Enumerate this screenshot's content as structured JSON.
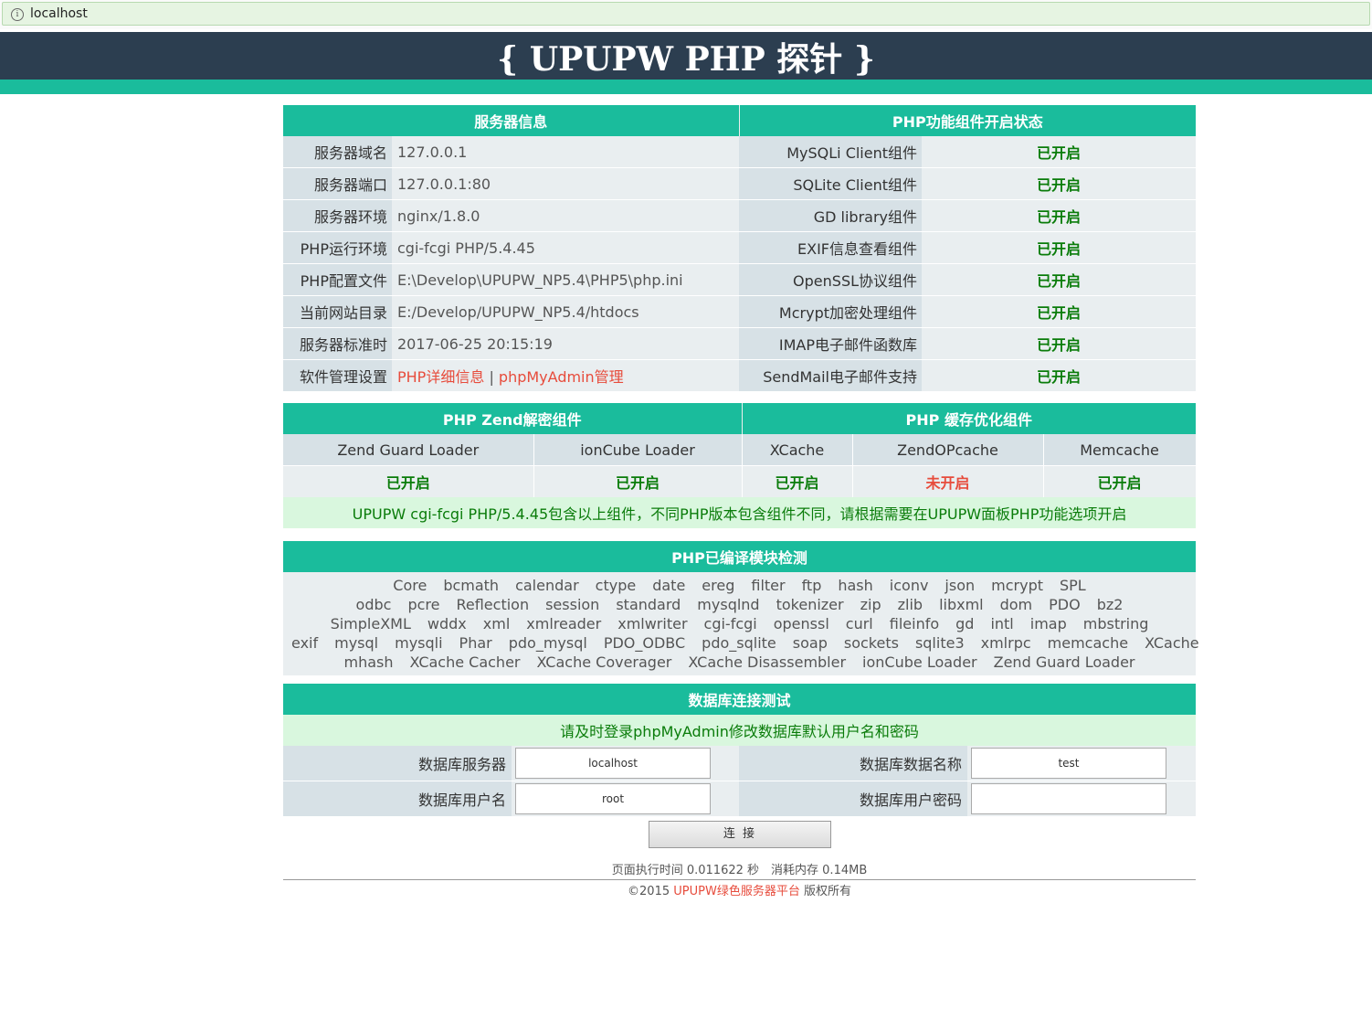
{
  "browser": {
    "url": "localhost"
  },
  "site_title": "{ UPUPW PHP 探针 }",
  "server_info": {
    "heading": "服务器信息",
    "rows": [
      {
        "label": "服务器域名",
        "value": "127.0.0.1"
      },
      {
        "label": "服务器端口",
        "value": "127.0.0.1:80"
      },
      {
        "label": "服务器环境",
        "value": "nginx/1.8.0"
      },
      {
        "label": "PHP运行环境",
        "value": "cgi-fcgi PHP/5.4.45"
      },
      {
        "label": "PHP配置文件",
        "value": "E:\\Develop\\UPUPW_NP5.4\\PHP5\\php.ini"
      },
      {
        "label": "当前网站目录",
        "value": "E:/Develop/UPUPW_NP5.4/htdocs"
      },
      {
        "label": "服务器标准时",
        "value": "2017-06-25 20:15:19"
      },
      {
        "label": "软件管理设置",
        "value": ""
      }
    ],
    "links": {
      "phpinfo": "PHP详细信息",
      "separator": "|",
      "phpmyadmin": "phpMyAdmin管理"
    }
  },
  "components": {
    "heading": "PHP功能组件开启状态",
    "rows": [
      {
        "label": "MySQLi Client组件",
        "status": "已开启"
      },
      {
        "label": "SQLite Client组件",
        "status": "已开启"
      },
      {
        "label": "GD library组件",
        "status": "已开启"
      },
      {
        "label": "EXIF信息查看组件",
        "status": "已开启"
      },
      {
        "label": "OpenSSL协议组件",
        "status": "已开启"
      },
      {
        "label": "Mcrypt加密处理组件",
        "status": "已开启"
      },
      {
        "label": "IMAP电子邮件函数库",
        "status": "已开启"
      },
      {
        "label": "SendMail电子邮件支持",
        "status": "已开启"
      }
    ]
  },
  "zend": {
    "heading": "PHP Zend解密组件",
    "cache_heading": "PHP 缓存优化组件",
    "items": [
      {
        "name": "Zend Guard Loader",
        "status": "已开启",
        "on": true
      },
      {
        "name": "ionCube Loader",
        "status": "已开启",
        "on": true
      },
      {
        "name": "XCache",
        "status": "已开启",
        "on": true
      },
      {
        "name": "ZendOPcache",
        "status": "未开启",
        "on": false
      },
      {
        "name": "Memcache",
        "status": "已开启",
        "on": true
      }
    ],
    "notice": "UPUPW cgi-fcgi PHP/5.4.45包含以上组件，不同PHP版本包含组件不同，请根据需要在UPUPW面板PHP功能选项开启"
  },
  "modules": {
    "heading": "PHP已编译模块检测",
    "lines": [
      [
        "Core",
        "bcmath",
        "calendar",
        "ctype",
        "date",
        "ereg",
        "filter",
        "ftp",
        "hash",
        "iconv",
        "json",
        "mcrypt",
        "SPL"
      ],
      [
        "odbc",
        "pcre",
        "Reflection",
        "session",
        "standard",
        "mysqlnd",
        "tokenizer",
        "zip",
        "zlib",
        "libxml",
        "dom",
        "PDO",
        "bz2"
      ],
      [
        "SimpleXML",
        "wddx",
        "xml",
        "xmlreader",
        "xmlwriter",
        "cgi-fcgi",
        "openssl",
        "curl",
        "fileinfo",
        "gd",
        "intl",
        "imap",
        "mbstring"
      ],
      [
        "exif",
        "mysql",
        "mysqli",
        "Phar",
        "pdo_mysql",
        "PDO_ODBC",
        "pdo_sqlite",
        "soap",
        "sockets",
        "sqlite3",
        "xmlrpc",
        "memcache",
        "XCache"
      ],
      [
        "mhash",
        "XCache Cacher",
        "XCache Coverager",
        "XCache Disassembler",
        "ionCube Loader",
        "Zend Guard Loader"
      ]
    ]
  },
  "db": {
    "heading": "数据库连接测试",
    "notice": "请及时登录phpMyAdmin修改数据库默认用户名和密码",
    "server_label": "数据库服务器",
    "server_value": "localhost",
    "dbname_label": "数据库数据名称",
    "dbname_value": "test",
    "user_label": "数据库用户名",
    "user_value": "root",
    "password_label": "数据库用户密码",
    "password_value": "",
    "connect_label": "连 接"
  },
  "footer": {
    "perf": "页面执行时间 0.011622 秒　消耗内存 0.14MB",
    "copy_prefix": "©2015 ",
    "copy_link": "UPUPW绿色服务器平台",
    "copy_suffix": " 版权所有"
  }
}
